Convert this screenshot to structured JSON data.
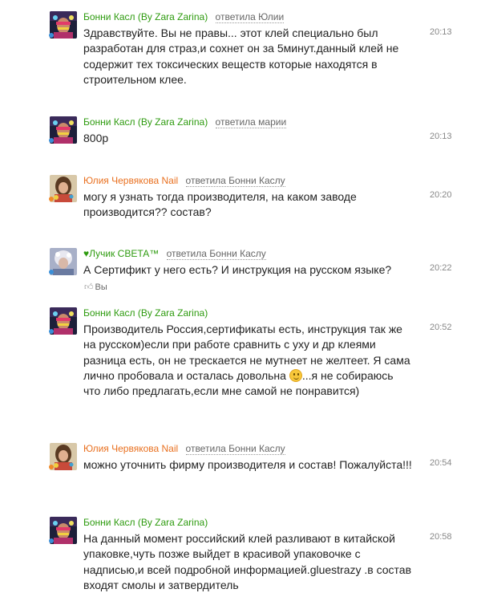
{
  "reply_prefix": "ответила",
  "comments": [
    {
      "author": "Бонни Касл (By Zara Zarina)",
      "reply_to": "ответила Юлии",
      "time": "20:13",
      "text": "Здравствуйте. Вы не правы... этот клей специально был разработан для страз,и сохнет он за 5минут.данный клей не содержит тех токсических веществ которые находятся в строительном клее."
    },
    {
      "author": "Бонни Касл (By Zara Zarina)",
      "reply_to": "ответила марии",
      "time": "20:13",
      "text": "800р"
    },
    {
      "author": "Юлия Червякова Nail",
      "reply_to": "ответила Бонни Каслу",
      "time": "20:20",
      "text": "могу я узнать тогда производителя, на каком заводе производится?? состав?"
    },
    {
      "author": "♥Лучик СВЕТА™",
      "reply_to": "ответила Бонни Каслу",
      "time": "20:22",
      "text": "А Сертификт у него есть? И инструкция на русском языке?",
      "like_label": "Вы"
    },
    {
      "author": "Бонни Касл (By Zara Zarina)",
      "reply_to": "",
      "time": "20:52",
      "text_before_smiley": "Производитель Россия,сертификаты есть, инструкция так же на русском)если при работе сравнить с ухy и др клеями разница есть, он не трескается не мутнеет не желтеет. Я сама лично пробовала и осталась довольна ",
      "text_after_smiley": "...я не собираюсь что либо предлагать,если мне самой не понравится)"
    },
    {
      "author": "Юлия Червякова Nail",
      "reply_to": "ответила Бонни Каслу",
      "time": "20:54",
      "text": "можно уточнить фирму производителя и состав! Пожалуйста!!!"
    },
    {
      "author": "Бонни Касл (By Zara Zarina)",
      "reply_to": "",
      "time": "20:58",
      "text": "На данный момент российский клей разливают в китайской упаковке,чуть позже выйдет в красивой упаковочке с надписью,и всей подробной информацией.gluestrazy .в состав входят смолы и затвердитель"
    }
  ],
  "colors": {
    "author_green": "#2e9b0f",
    "author_orange": "#e9701f",
    "online_blue": "#3a8fd8",
    "online_orange": "#f08a2a"
  }
}
